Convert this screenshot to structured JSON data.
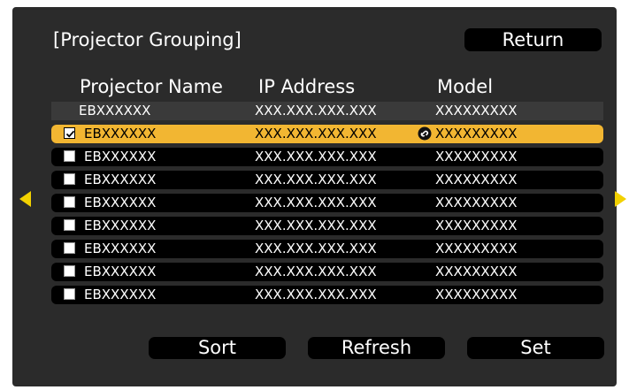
{
  "window": {
    "title": "[Projector Grouping]",
    "return_label": "Return"
  },
  "columns": {
    "name": "Projector Name",
    "ip": "IP Address",
    "model": "Model"
  },
  "rows": [
    {
      "name": "EBXXXXXX",
      "ip": "XXX.XXX.XXX.XXX",
      "model": "XXXXXXXXX",
      "checkbox": false,
      "selected": false,
      "linked": false
    },
    {
      "name": "EBXXXXXX",
      "ip": "XXX.XXX.XXX.XXX",
      "model": "XXXXXXXXX",
      "checkbox": true,
      "checked": true,
      "selected": true,
      "linked": true
    },
    {
      "name": "EBXXXXXX",
      "ip": "XXX.XXX.XXX.XXX",
      "model": "XXXXXXXXX",
      "checkbox": true,
      "checked": false
    },
    {
      "name": "EBXXXXXX",
      "ip": "XXX.XXX.XXX.XXX",
      "model": "XXXXXXXXX",
      "checkbox": true,
      "checked": false
    },
    {
      "name": "EBXXXXXX",
      "ip": "XXX.XXX.XXX.XXX",
      "model": "XXXXXXXXX",
      "checkbox": true,
      "checked": false
    },
    {
      "name": "EBXXXXXX",
      "ip": "XXX.XXX.XXX.XXX",
      "model": "XXXXXXXXX",
      "checkbox": true,
      "checked": false
    },
    {
      "name": "EBXXXXXX",
      "ip": "XXX.XXX.XXX.XXX",
      "model": "XXXXXXXXX",
      "checkbox": true,
      "checked": false
    },
    {
      "name": "EBXXXXXX",
      "ip": "XXX.XXX.XXX.XXX",
      "model": "XXXXXXXXX",
      "checkbox": true,
      "checked": false
    },
    {
      "name": "EBXXXXXX",
      "ip": "XXX.XXX.XXX.XXX",
      "model": "XXXXXXXXX",
      "checkbox": true,
      "checked": false
    }
  ],
  "buttons": {
    "sort": "Sort",
    "refresh": "Refresh",
    "set": "Set"
  },
  "icons": {
    "page_left": "triangle-left-icon",
    "page_right": "triangle-right-icon",
    "link": "link-icon",
    "check": "check-icon"
  },
  "colors": {
    "background": "#2b2b2b",
    "selected_row": "#f2b632",
    "arrow": "#f2d100",
    "button": "#000000"
  }
}
